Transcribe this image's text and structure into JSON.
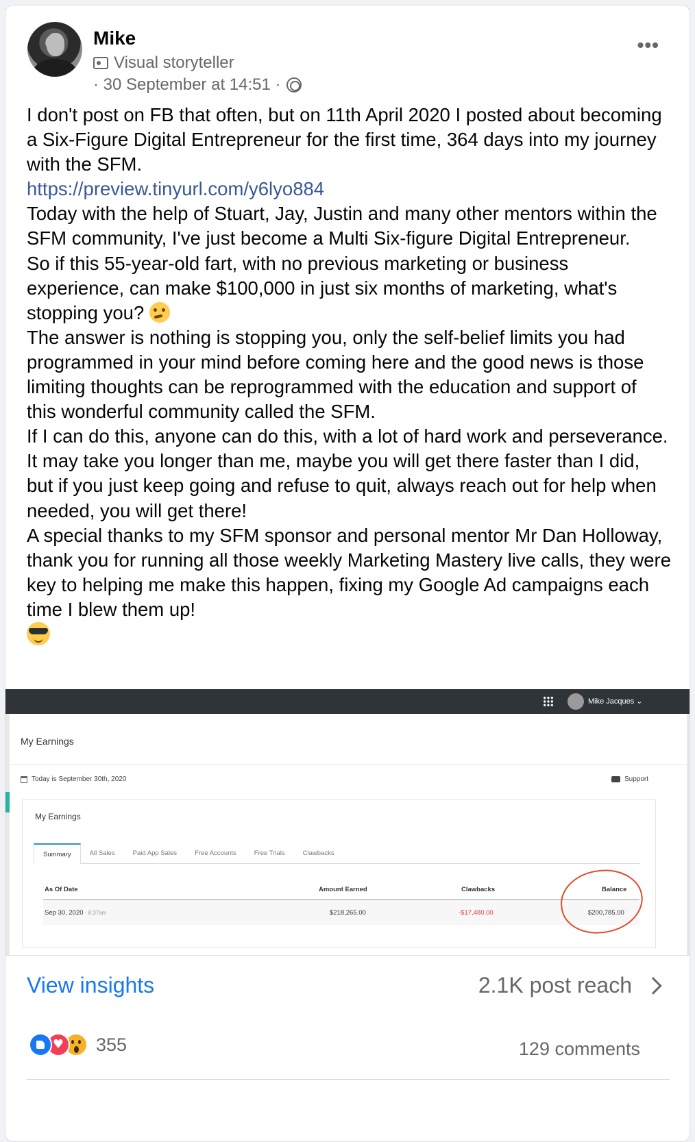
{
  "author": {
    "name": "Mike",
    "role": "Visual storyteller",
    "timestamp": "· 30 September at 14:51 ·"
  },
  "icons": {
    "role": "badge-icon",
    "audience": "globe-icon",
    "more": "ellipsis-icon",
    "thinking": "thinking-face-emoji",
    "cool": "sunglasses-face-emoji"
  },
  "post": {
    "p1": "I don't post on FB that often, but on 11th April 2020 I posted about becoming a Six-Figure Digital Entrepreneur for the first time, 364 days into my journey with the SFM.",
    "link": "https://preview.tinyurl.com/y6lyo884",
    "p2": "Today with the help of Stuart, Jay, Justin and many other mentors within the SFM community, I've just become a Multi Six-figure Digital Entrepreneur.",
    "p3": "So if this 55-year-old fart, with no previous marketing or business experience, can make $100,000 in just six months of marketing, what's stopping you?",
    "p4": "The answer is nothing is stopping you, only the self-belief limits you had programmed in your mind before coming here and the good news is those limiting thoughts can be reprogrammed with the education and support of this wonderful community called the SFM.",
    "p5": "If I can do this, anyone can do this, with a lot of hard work and perseverance. It may take you longer than me, maybe you will get there faster than I did, but if you just keep going and refuse to quit, always reach out for help when needed, you will get there!",
    "p6": "A special thanks to my SFM sponsor and personal mentor Mr Dan Holloway, thank you for running all those weekly Marketing Mastery live calls, they were key to helping me make this happen, fixing my Google Ad campaigns each time I blew them up!"
  },
  "screenshot": {
    "user": "Mike Jacques ⌄",
    "page_title": "My Earnings",
    "today": "Today is September 30th, 2020",
    "support": "Support",
    "panel_title": "My Earnings",
    "tabs": [
      "Summary",
      "All Sales",
      "Paid App Sales",
      "Free Accounts",
      "Free Trials",
      "Clawbacks"
    ],
    "headers": {
      "date": "As Of Date",
      "earned": "Amount Earned",
      "clawbacks": "Clawbacks",
      "balance": "Balance"
    },
    "row": {
      "date": "Sep 30, 2020",
      "time": " - 8:37am",
      "earned": "$218,265.00",
      "clawbacks": "-$17,480.00",
      "balance": "$200,785.00"
    }
  },
  "footer": {
    "insights": "View insights",
    "reach": "2.1K post reach",
    "reactions_count": "355",
    "comments": "129 comments"
  },
  "colors": {
    "link": "#385898",
    "insights": "#1877f2",
    "negative": "#e53935",
    "highlight_circle": "#e24a2b"
  }
}
